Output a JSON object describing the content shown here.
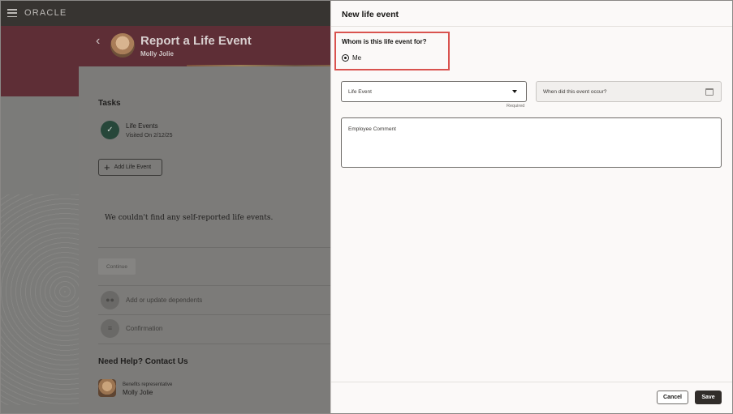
{
  "header": {
    "brand": "ORACLE"
  },
  "page": {
    "title": "Report a Life Event",
    "subtitle": "Molly Jolie"
  },
  "tasks": {
    "title": "Tasks",
    "completed": {
      "label": "Life Events",
      "sub": "Visited On 2/12/25"
    },
    "add_button": "Add Life Event",
    "empty_message": "We couldn't find any self-reported life events.",
    "continue_button": "Continue",
    "steps": [
      "Add or update dependents",
      "Confirmation"
    ]
  },
  "help": {
    "title": "Need Help? Contact Us",
    "role": "Benefits representative",
    "name": "Molly Jolie"
  },
  "drawer": {
    "title": "New life event",
    "question": "Whom is this life event for?",
    "radio_option": "Me",
    "life_event_placeholder": "Life Event",
    "required_label": "Required",
    "date_placeholder": "When did this event occur?",
    "comment_placeholder": "Employee Comment",
    "cancel_button": "Cancel",
    "save_button": "Save"
  },
  "colors": {
    "highlight": "#d9534f",
    "primary_button": "#312d2a",
    "banner": "#5e2e36"
  },
  "icons": [
    "menu-icon",
    "chevron-left-icon",
    "check-icon",
    "plus-icon",
    "dependents-icon",
    "confirmation-icon",
    "caret-down-icon",
    "calendar-icon"
  ]
}
